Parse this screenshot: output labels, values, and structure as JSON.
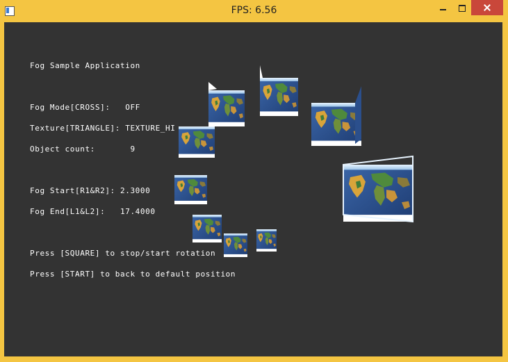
{
  "window": {
    "title": "FPS: 6.56"
  },
  "overlay": {
    "app_title": "Fog Sample Application",
    "fog_mode": "Fog Mode[CROSS]:   OFF",
    "texture": "Texture[TRIANGLE]: TEXTURE_HI",
    "object_count": "Object count:       9",
    "fog_start": "Fog Start[R1&R2]: 2.3000",
    "fog_end": "Fog End[L1&L2]:   17.4000",
    "hint_square": "Press [SQUARE] to stop/start rotation",
    "hint_start": "Press [START] to back to default position"
  },
  "colors": {
    "client_bg": "#333333",
    "frame": "#f4c542",
    "close_button": "#c9473a",
    "ocean": "#2b4f8c",
    "land": "#d9a43a",
    "ice": "#ffffff"
  },
  "icons": {
    "app": "app-icon",
    "minimize": "minimize-icon",
    "maximize": "maximize-icon",
    "close": "close-icon"
  },
  "scene": {
    "object_type": "textured-earth-panel",
    "count": 9
  }
}
